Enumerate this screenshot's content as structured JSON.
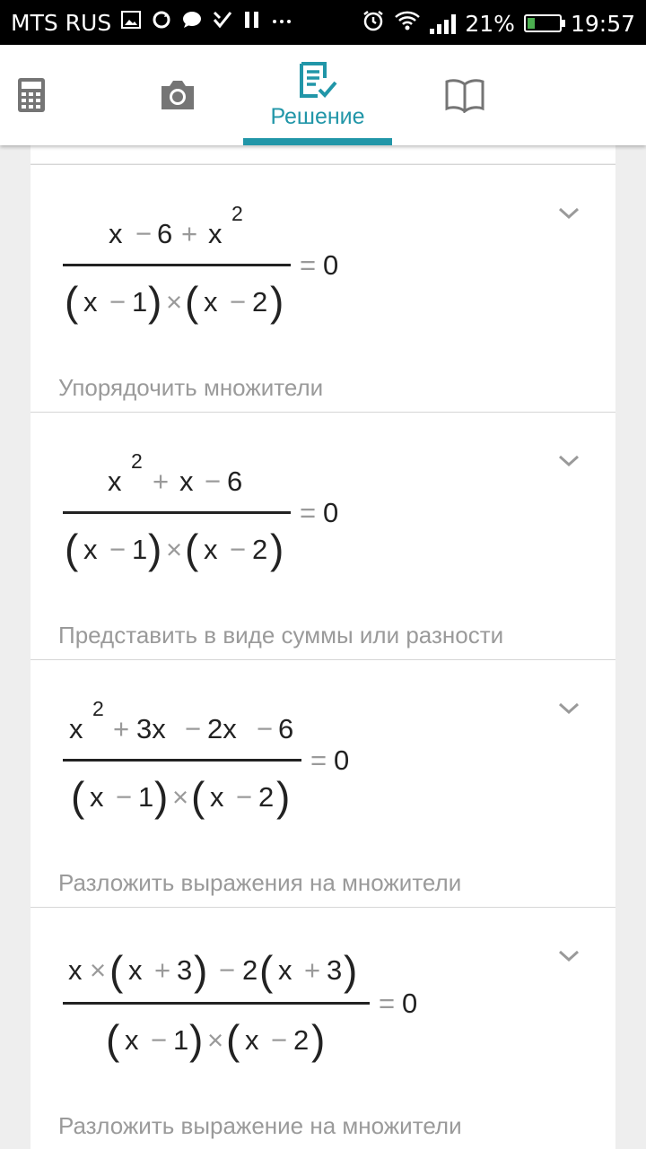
{
  "status_bar": {
    "carrier": "MTS RUS",
    "battery": "21%",
    "battery_level": 0.21,
    "time": "19:57",
    "colors": {
      "background": "#000000",
      "text": "#ffffff",
      "battery_fill": "#4caf50"
    }
  },
  "tabs": [
    {
      "icon": "calculator-icon"
    },
    {
      "icon": "camera-icon"
    },
    {
      "icon": "solution-icon",
      "label": "Решение",
      "selected": true
    },
    {
      "icon": "book-icon"
    }
  ],
  "colors": {
    "accent": "#2196a8",
    "muted": "#9a9a9a",
    "card": "#ffffff",
    "background": "#eeeeee"
  },
  "steps": [
    {
      "numerator": [
        "x",
        "−",
        "6",
        "+",
        "x",
        "2"
      ],
      "denominator": [
        "(",
        "x",
        "−",
        "1",
        ")",
        "×",
        "(",
        "x",
        "−",
        "2",
        ")"
      ],
      "equals": "=",
      "rhs": "0",
      "description": "Упорядочить множители"
    },
    {
      "numerator": [
        "x",
        "2",
        "+",
        "x",
        "−",
        "6"
      ],
      "denominator": [
        "(",
        "x",
        "−",
        "1",
        ")",
        "×",
        "(",
        "x",
        "−",
        "2",
        ")"
      ],
      "equals": "=",
      "rhs": "0",
      "description": "Представить в виде суммы или разности"
    },
    {
      "numerator": [
        "x",
        "2",
        "+",
        "3x",
        "−",
        "2x",
        "−",
        "6"
      ],
      "denominator": [
        "(",
        "x",
        "−",
        "1",
        ")",
        "×",
        "(",
        "x",
        "−",
        "2",
        ")"
      ],
      "equals": "=",
      "rhs": "0",
      "description": "Разложить выражения на множители"
    },
    {
      "numerator": [
        "x",
        "×",
        "(",
        "x",
        "+",
        "3",
        ")",
        "−",
        "2",
        "(",
        "x",
        "+",
        "3",
        ")"
      ],
      "denominator": [
        "(",
        "x",
        "−",
        "1",
        ")",
        "×",
        "(",
        "x",
        "−",
        "2",
        ")"
      ],
      "equals": "=",
      "rhs": "0",
      "description": "Разложить выражение на множители"
    }
  ]
}
